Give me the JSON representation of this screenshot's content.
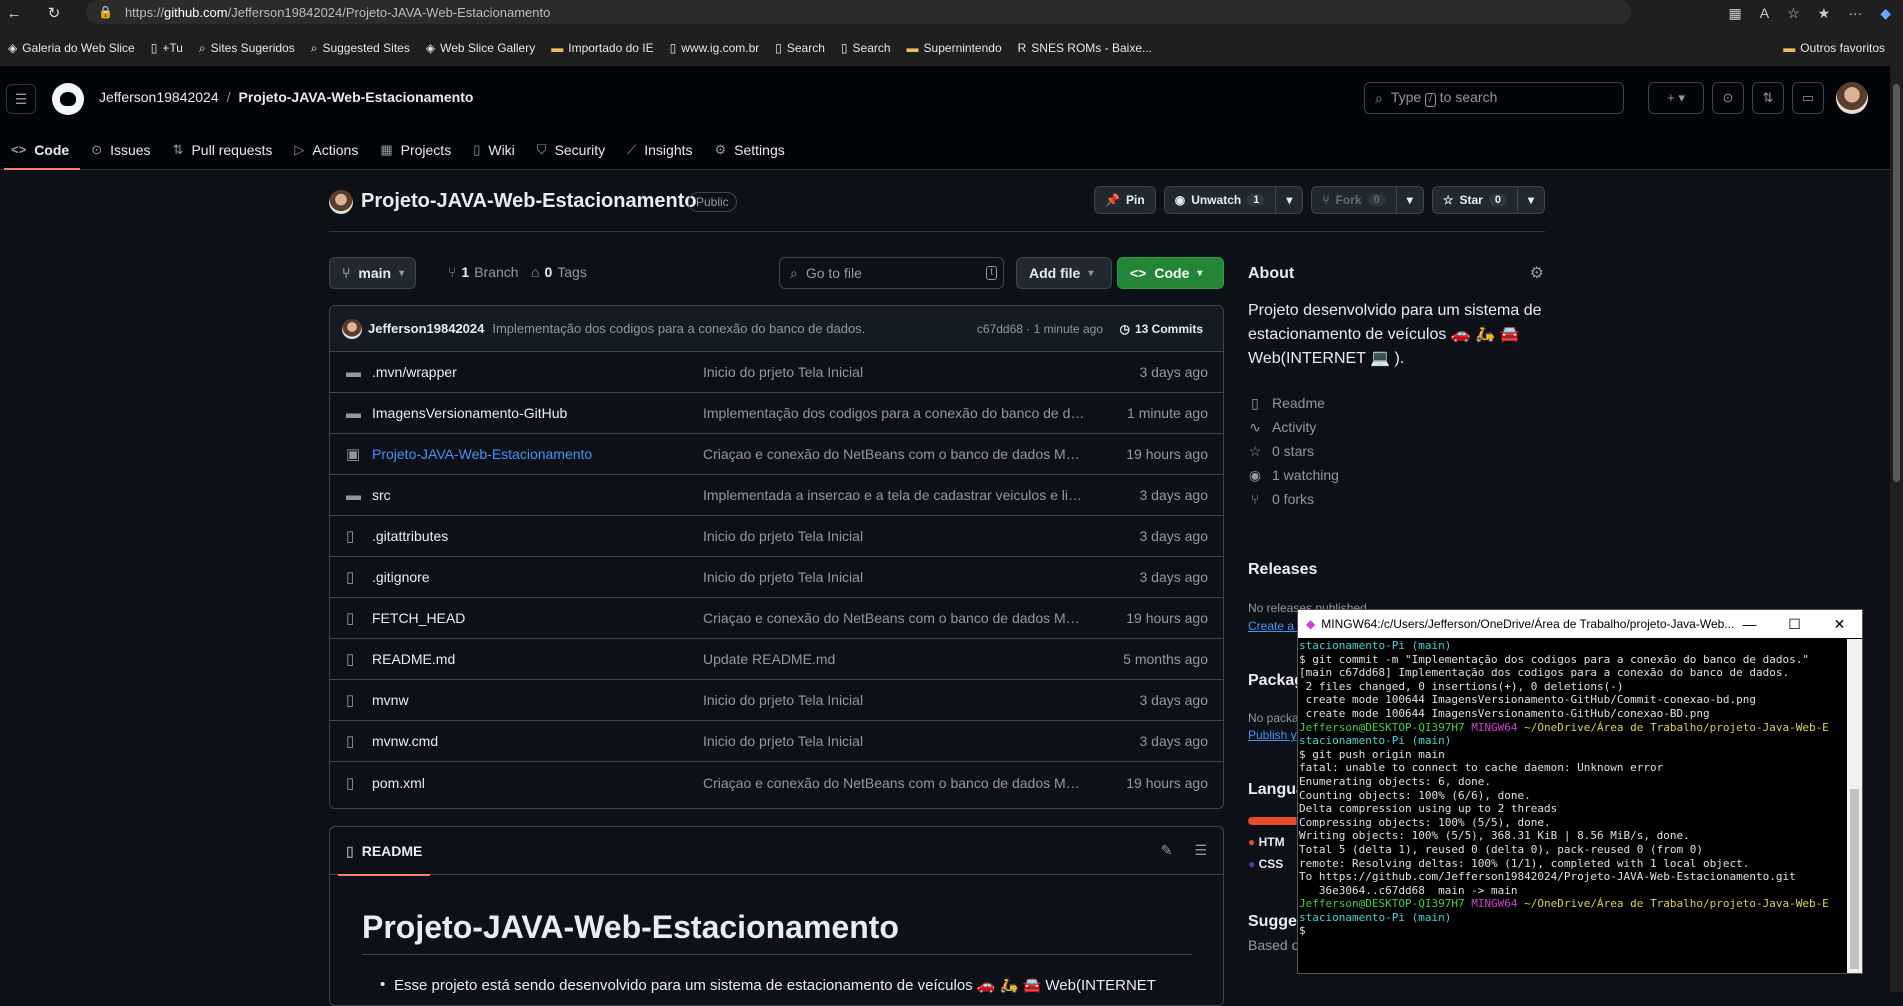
{
  "browser": {
    "url_prefix": "https://",
    "url_domain": "github.com",
    "url_path": "/Jefferson19842024/Projeto-JAVA-Web-Estacionamento",
    "favorites": [
      {
        "label": "Galeria do Web Slice",
        "icon": "web-slice-icon"
      },
      {
        "label": "+Tu",
        "icon": "page-icon"
      },
      {
        "label": "Sites Sugeridos",
        "icon": "search-icon"
      },
      {
        "label": "Suggested Sites",
        "icon": "search-icon"
      },
      {
        "label": "Web Slice Gallery",
        "icon": "web-slice-icon"
      },
      {
        "label": "Importado do IE",
        "icon": "folder-icon"
      },
      {
        "label": "www.ig.com.br",
        "icon": "page-icon"
      },
      {
        "label": "Search",
        "icon": "page-icon"
      },
      {
        "label": "Search",
        "icon": "page-icon"
      },
      {
        "label": "Supernintendo",
        "icon": "folder-icon"
      },
      {
        "label": "SNES ROMs - Baixe...",
        "icon": "rom-icon"
      }
    ],
    "other_favorites": "Outros favoritos"
  },
  "header": {
    "owner": "Jefferson19842024",
    "separator": "/",
    "repo": "Projeto-JAVA-Web-Estacionamento",
    "search_prefix": "Type",
    "search_key": "/",
    "search_suffix": "to search",
    "tabs": [
      {
        "label": "Code",
        "icon": "code-icon"
      },
      {
        "label": "Issues",
        "icon": "issue-icon"
      },
      {
        "label": "Pull requests",
        "icon": "pull-request-icon"
      },
      {
        "label": "Actions",
        "icon": "play-icon"
      },
      {
        "label": "Projects",
        "icon": "table-icon"
      },
      {
        "label": "Wiki",
        "icon": "book-icon"
      },
      {
        "label": "Security",
        "icon": "shield-icon"
      },
      {
        "label": "Insights",
        "icon": "graph-icon"
      },
      {
        "label": "Settings",
        "icon": "gear-icon"
      }
    ]
  },
  "repo": {
    "name": "Projeto-JAVA-Web-Estacionamento",
    "visibility": "Public",
    "pin": "Pin",
    "unwatch": "Unwatch",
    "watch_count": "1",
    "fork": "Fork",
    "fork_count": "0",
    "star": "Star",
    "star_count": "0"
  },
  "branch_bar": {
    "branch": "main",
    "branches_count": "1",
    "branches_label": "Branch",
    "tags_count": "0",
    "tags_label": "Tags",
    "goto_placeholder": "Go to file",
    "goto_key": "t",
    "add_file": "Add file",
    "code": "Code"
  },
  "latest_commit": {
    "author": "Jefferson19842024",
    "message": "Implementação dos codigos para a conexão do banco de dados.",
    "hash_time": "c67dd68 · 1 minute ago",
    "commits": "13 Commits"
  },
  "files": [
    {
      "name": ".mvn/wrapper",
      "type": "dir",
      "message": "Inicio do prjeto Tela Inicial",
      "date": "3 days ago"
    },
    {
      "name": "ImagensVersionamento-GitHub",
      "type": "dir",
      "message": "Implementação dos codigos para a conexão do banco de da...",
      "date": "1 minute ago"
    },
    {
      "name": "Projeto-JAVA-Web-Estacionamento",
      "type": "submodule",
      "message": "Criaçao e conexão do NetBeans com o banco de dados MYS...",
      "date": "19 hours ago"
    },
    {
      "name": "src",
      "type": "dir",
      "message": "Implementada a insercao e a tela de cadastrar veiculos e list...",
      "date": "3 days ago"
    },
    {
      "name": ".gitattributes",
      "type": "file",
      "message": "Inicio do prjeto Tela Inicial",
      "date": "3 days ago"
    },
    {
      "name": ".gitignore",
      "type": "file",
      "message": "Inicio do prjeto Tela Inicial",
      "date": "3 days ago"
    },
    {
      "name": "FETCH_HEAD",
      "type": "file",
      "message": "Criaçao e conexão do NetBeans com o banco de dados MYS...",
      "date": "19 hours ago"
    },
    {
      "name": "README.md",
      "type": "file",
      "message": "Update README.md",
      "date": "5 months ago"
    },
    {
      "name": "mvnw",
      "type": "file",
      "message": "Inicio do prjeto Tela Inicial",
      "date": "3 days ago"
    },
    {
      "name": "mvnw.cmd",
      "type": "file",
      "message": "Inicio do prjeto Tela Inicial",
      "date": "3 days ago"
    },
    {
      "name": "pom.xml",
      "type": "file",
      "message": "Criaçao e conexão do NetBeans com o banco de dados MYS...",
      "date": "19 hours ago"
    }
  ],
  "readme": {
    "tab": "README",
    "title": "Projeto-JAVA-Web-Estacionamento",
    "bullet": "Esse projeto está sendo desenvolvido para um sistema de estacionamento de veículos 🚗 🛵 🚘 Web(INTERNET"
  },
  "about": {
    "title": "About",
    "description": "Projeto desenvolvido para um sistema de estacionamento de veículos 🚗 🛵 🚘 Web(INTERNET 💻 ).",
    "items": [
      {
        "label": "Readme",
        "icon": "book-icon"
      },
      {
        "label": "Activity",
        "icon": "pulse-icon"
      },
      {
        "label": "0 stars",
        "icon": "star-icon"
      },
      {
        "label": "1 watching",
        "icon": "eye-icon"
      },
      {
        "label": "0 forks",
        "icon": "fork-icon"
      }
    ],
    "releases": "Releases",
    "releases_none": "No releases published",
    "releases_link": "Create a new release",
    "packages": "Packag",
    "packages_none": "No packa",
    "packages_link": "Publish y",
    "languages": "Langua",
    "lang1": "HTM",
    "lang2": "CSS",
    "suggested": "Sugge",
    "suggested_sub": "Based o"
  },
  "terminal": {
    "title": "MINGW64:/c/Users/Jefferson/OneDrive/Área de Trabalho/projeto-Java-Web...",
    "lines": [
      {
        "t": "stacionamento-Pi (main)",
        "c": "c"
      },
      {
        "t": "$ git commit -m \"Implementação dos codigos para a conexão do banco de dados.\"",
        "c": ""
      },
      {
        "t": "[main c67dd68] Implementação dos codigos para a conexão do banco de dados.",
        "c": ""
      },
      {
        "t": " 2 files changed, 0 insertions(+), 0 deletions(-)",
        "c": ""
      },
      {
        "t": " create mode 100644 ImagensVersionamento-GitHub/Commit-conexao-bd.png",
        "c": ""
      },
      {
        "t": " create mode 100644 ImagensVersionamento-GitHub/conexao-BD.png",
        "c": ""
      },
      {
        "t": "",
        "c": ""
      },
      {
        "t": "Jefferson@DESKTOP-QI397H7 MINGW64 ~/OneDrive/Área de Trabalho/projeto-Java-Web-E",
        "c": "prompt"
      },
      {
        "t": "stacionamento-Pi (main)",
        "c": "c"
      },
      {
        "t": "$ git push origin main",
        "c": ""
      },
      {
        "t": "fatal: unable to connect to cache daemon: Unknown error",
        "c": ""
      },
      {
        "t": "Enumerating objects: 6, done.",
        "c": ""
      },
      {
        "t": "Counting objects: 100% (6/6), done.",
        "c": ""
      },
      {
        "t": "Delta compression using up to 2 threads",
        "c": ""
      },
      {
        "t": "Compressing objects: 100% (5/5), done.",
        "c": ""
      },
      {
        "t": "Writing objects: 100% (5/5), 368.31 KiB | 8.56 MiB/s, done.",
        "c": ""
      },
      {
        "t": "Total 5 (delta 1), reused 0 (delta 0), pack-reused 0 (from 0)",
        "c": ""
      },
      {
        "t": "remote: Resolving deltas: 100% (1/1), completed with 1 local object.",
        "c": ""
      },
      {
        "t": "To https://github.com/Jefferson19842024/Projeto-JAVA-Web-Estacionamento.git",
        "c": ""
      },
      {
        "t": "   36e3064..c67dd68  main -> main",
        "c": ""
      },
      {
        "t": "",
        "c": ""
      },
      {
        "t": "Jefferson@DESKTOP-QI397H7 MINGW64 ~/OneDrive/Área de Trabalho/projeto-Java-Web-E",
        "c": "prompt"
      },
      {
        "t": "stacionamento-Pi (main)",
        "c": "c"
      },
      {
        "t": "$",
        "c": ""
      }
    ]
  }
}
